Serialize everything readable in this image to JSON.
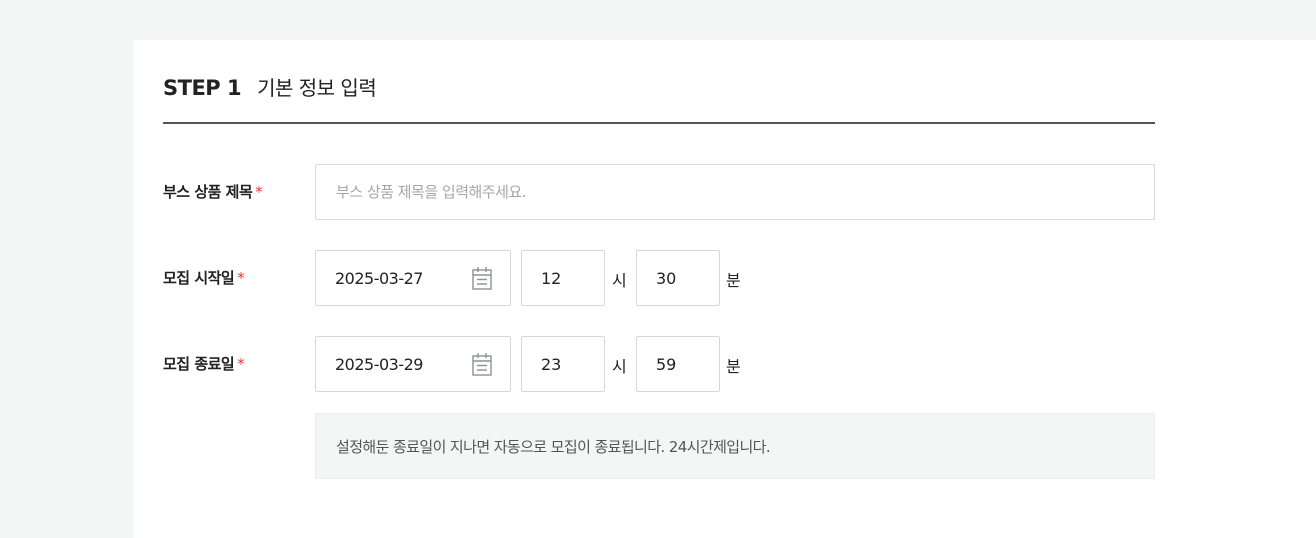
{
  "step": {
    "number_label": "STEP 1",
    "title": "기본 정보 입력"
  },
  "fields": {
    "booth_title": {
      "label": "부스 상품 제목",
      "required_mark": "*",
      "placeholder": "부스 상품 제목을 입력해주세요.",
      "value": ""
    },
    "recruit_start": {
      "label": "모집 시작일",
      "required_mark": "*",
      "date": "2025-03-27",
      "hour": "12",
      "hour_unit": "시",
      "minute": "30",
      "minute_unit": "분",
      "calendar_icon": "calendar-icon"
    },
    "recruit_end": {
      "label": "모집 종료일",
      "required_mark": "*",
      "date": "2025-03-29",
      "hour": "23",
      "hour_unit": "시",
      "minute": "59",
      "minute_unit": "분",
      "calendar_icon": "calendar-icon"
    }
  },
  "notice": "설정해둔 종료일이 지나면 자동으로 모집이 종료됩니다. 24시간제입니다.",
  "colors": {
    "required": "#e03a3a",
    "page_bg": "#f4f5f5",
    "rule": "#555555",
    "border": "#d5d7da"
  }
}
